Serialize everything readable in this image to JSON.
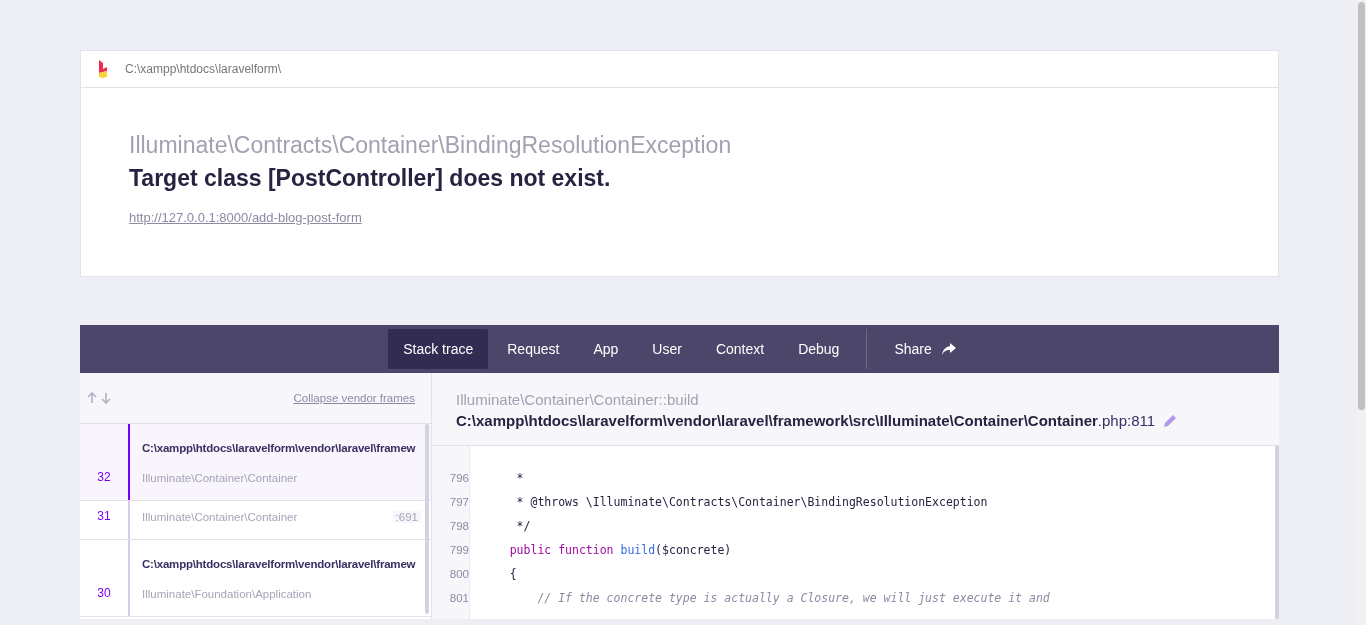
{
  "header": {
    "path": "C:\\xampp\\htdocs\\laravelform\\",
    "exception_class": "Illuminate\\Contracts\\Container\\BindingResolutionException",
    "message": "Target class [PostController] does not exist.",
    "url": "http://127.0.0.1:8000/add-blog-post-form"
  },
  "tabs": [
    {
      "label": "Stack trace",
      "selected": true,
      "kind": "tab"
    },
    {
      "label": "Request",
      "selected": false,
      "kind": "tab"
    },
    {
      "label": "App",
      "selected": false,
      "kind": "tab"
    },
    {
      "label": "User",
      "selected": false,
      "kind": "tab"
    },
    {
      "label": "Context",
      "selected": false,
      "kind": "tab"
    },
    {
      "label": "Debug",
      "selected": false,
      "kind": "tab"
    },
    {
      "label": "Share",
      "selected": false,
      "kind": "share"
    }
  ],
  "frames_panel": {
    "collapse_link": "Collapse vendor frames",
    "frames": [
      {
        "number": "32",
        "file": "C:\\xampp\\htdocs\\laravelform\\vendor\\laravel\\framew",
        "class": "Illuminate\\Container\\Container",
        "selected": true
      },
      {
        "number": "31",
        "class": "Illuminate\\Container\\Container",
        "line": ":691",
        "selected": false
      },
      {
        "number": "30",
        "file": "C:\\xampp\\htdocs\\laravelform\\vendor\\laravel\\framew",
        "class": "Illuminate\\Foundation\\Application",
        "selected": false
      }
    ]
  },
  "code_panel": {
    "method": "Illuminate\\Container\\Container::build",
    "file": "**C:\\xampp\\htdocs\\laravelform\\vendor\\laravel\\framework\\src\\Illuminate\\Container\\Container**.php:811",
    "lines": [
      {
        "number": "796",
        "tokens": [
          {
            "kind": "plain",
            "text": "     *"
          }
        ]
      },
      {
        "number": "797",
        "tokens": [
          {
            "kind": "plain",
            "text": "     * @throws \\Illuminate\\Contracts\\Container\\BindingResolutionException"
          }
        ]
      },
      {
        "number": "798",
        "tokens": [
          {
            "kind": "plain",
            "text": "     */"
          }
        ]
      },
      {
        "number": "799",
        "tokens": [
          {
            "kind": "keyword",
            "text": "    public function "
          },
          {
            "kind": "name",
            "text": "build"
          },
          {
            "kind": "plain",
            "text": "($concrete)"
          }
        ]
      },
      {
        "number": "800",
        "tokens": [
          {
            "kind": "plain",
            "text": "    {"
          }
        ]
      },
      {
        "number": "801",
        "tokens": [
          {
            "kind": "comment",
            "text": "        // If the concrete type is actually a Closure, we will just execute it and"
          }
        ]
      }
    ]
  }
}
